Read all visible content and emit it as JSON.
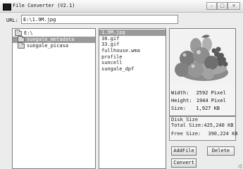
{
  "window": {
    "title": "File Converter (V2.1)",
    "minimize_label": "–",
    "maximize_label": "□",
    "close_label": "×"
  },
  "url": {
    "label": "URL:",
    "value": "E:\\1.9M.jpg"
  },
  "tree": {
    "items": [
      {
        "label": "E:\\",
        "selected": false,
        "indent": 0
      },
      {
        "label": "sungale_metadata",
        "selected": true,
        "indent": 1
      },
      {
        "label": "sungale_picasa",
        "selected": false,
        "indent": 1
      }
    ]
  },
  "files": {
    "items": [
      "1.9M.jpg",
      "30.gif",
      "33.gif",
      "fullhouse.wma",
      "profile",
      "suncell",
      "sungale_dpf"
    ],
    "selected_index": 0
  },
  "preview": {
    "width_label": "Width:",
    "width_value": "2592 Pixel",
    "height_label": "Height:",
    "height_value": "1944 Pixel",
    "size_label": "Size:",
    "size_value": "1,927 KB"
  },
  "disk": {
    "title": "Disk Size",
    "total_label": "Total Size:",
    "total_value": "425,240 KB",
    "free_label": "Free Size:",
    "free_value": "390,224 KB"
  },
  "buttons": {
    "add_file": "AddFile",
    "delete": "Delete",
    "convert": "Convert"
  },
  "colors": {
    "selection": "#9a9a9a",
    "background": "#ececec"
  }
}
